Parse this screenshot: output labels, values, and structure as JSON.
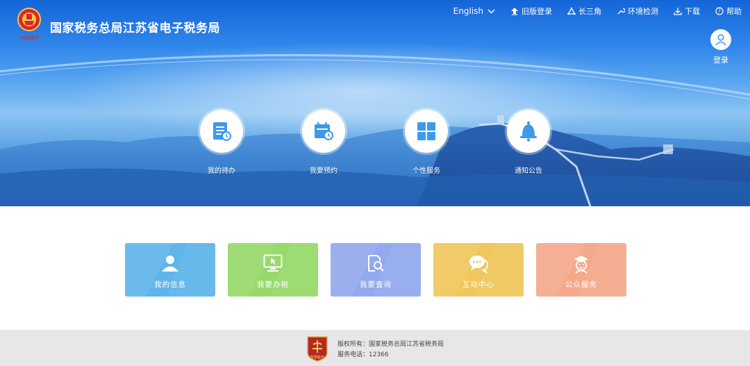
{
  "header": {
    "title": "国家税务总局江苏省电子税务局",
    "seal_text": "中国税务",
    "nav": {
      "language": "English",
      "old_version": "旧版登录",
      "yangtze_delta": "长三角",
      "env_check": "环境检测",
      "download": "下载",
      "help": "帮助"
    },
    "login_label": "登录"
  },
  "quick_links": [
    {
      "label": "我的待办",
      "icon": "todo-list-icon"
    },
    {
      "label": "我要预约",
      "icon": "calendar-clock-icon"
    },
    {
      "label": "个性服务",
      "icon": "grid-icon"
    },
    {
      "label": "通知公告",
      "icon": "bell-icon"
    }
  ],
  "cards": [
    {
      "label": "我的信息",
      "icon": "user-icon",
      "color": "#5fb5ea"
    },
    {
      "label": "我要办税",
      "icon": "monitor-cursor-icon",
      "color": "#97d96b"
    },
    {
      "label": "我要查询",
      "icon": "document-search-icon",
      "color": "#93a9ee"
    },
    {
      "label": "互动中心",
      "icon": "chat-bubbles-icon",
      "color": "#efc75c"
    },
    {
      "label": "公众服务",
      "icon": "service-person-icon",
      "color": "#f5a98b"
    }
  ],
  "footer": {
    "logo_text": "智慧税务",
    "copyright": "版权所有：国家税务总局江苏省税务局",
    "phone": "服务电话：12366"
  },
  "colors": {
    "hero_blue": "#2f86ea",
    "icon_blue": "#3d9ae8",
    "footer_bg": "#e7e7ea"
  }
}
